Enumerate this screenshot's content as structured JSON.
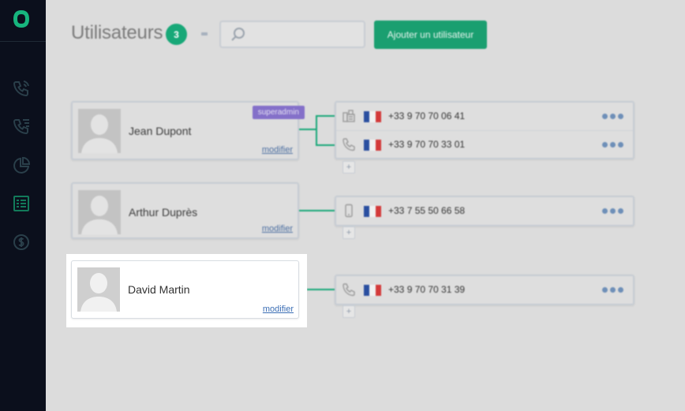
{
  "header": {
    "title": "Utilisateurs",
    "count": "3",
    "search_placeholder": "",
    "add_button": "Ajouter un utilisateur"
  },
  "sidebar": {
    "icons": [
      "logo-icon",
      "calls-icon",
      "call-list-icon",
      "stats-pie-icon",
      "users-list-icon",
      "billing-dollar-icon"
    ]
  },
  "users": [
    {
      "name": "Jean Dupont",
      "role": "superadmin",
      "edit": "modifier",
      "lines": [
        {
          "type": "fax-icon",
          "number": "+33 9 70 70 06 41"
        },
        {
          "type": "phone-icon",
          "number": "+33 9 70 70 33 01"
        }
      ]
    },
    {
      "name": "Arthur Duprès",
      "role": "",
      "edit": "modifier",
      "lines": [
        {
          "type": "mobile-icon",
          "number": "+33 7 55 50 66 58"
        }
      ]
    },
    {
      "name": "David Martin",
      "role": "",
      "edit": "modifier",
      "lines": [
        {
          "type": "phone-icon",
          "number": "+33 9 70 70 31 39"
        }
      ]
    }
  ],
  "add_line_label": "+",
  "colors": {
    "accent": "#18a878",
    "sidebar": "#0b0f1c",
    "role_badge": "#8470c9",
    "link": "#3c6fb5"
  }
}
